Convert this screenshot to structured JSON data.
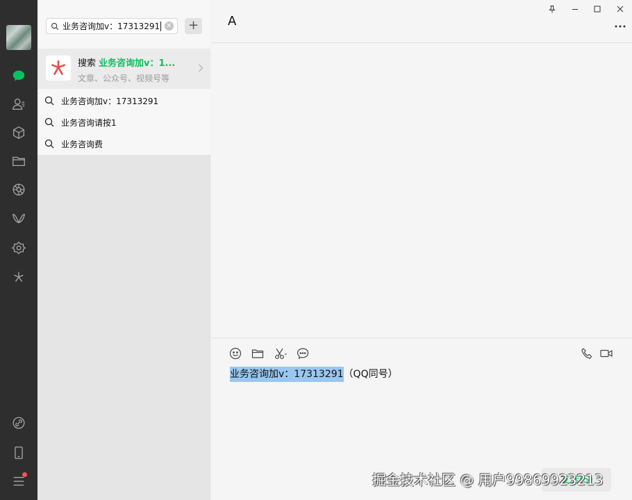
{
  "sidebar": {
    "icons": [
      "chat-icon",
      "contacts-icon",
      "favorites-box-icon",
      "folder-icon",
      "moments-icon",
      "channels-icon",
      "mini-programs-icon",
      "search-star-icon",
      "link-icon",
      "phone-icon",
      "menu-icon"
    ],
    "active_color": "#07c160",
    "notification_color": "#fa5151"
  },
  "search": {
    "value": "业务咨询加v：17313291"
  },
  "results": {
    "card_label": "搜索",
    "card_keyword": "业务咨询加v：1...",
    "card_subtitle": "文章、公众号、视频号等",
    "suggestions": [
      "业务咨询加v：17313291",
      "业务咨询请按1",
      "业务咨询费"
    ]
  },
  "chat": {
    "title": "A",
    "input_selected": "业务咨询加v：17313291",
    "input_rest": "（QQ同号）",
    "send_label": "发送(S)"
  },
  "watermark": "掘金技术社区 @ 用户99869923213"
}
